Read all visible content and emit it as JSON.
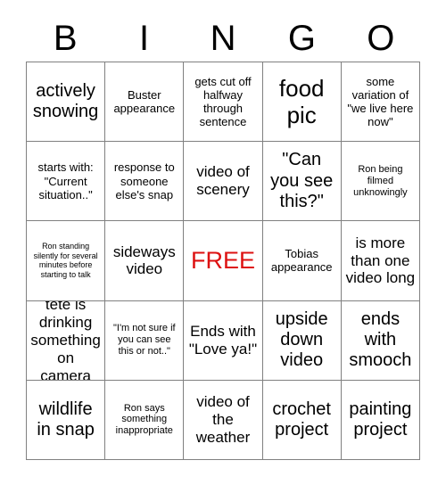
{
  "card": {
    "title": "BINGO",
    "header_letters": [
      "B",
      "I",
      "N",
      "G",
      "O"
    ],
    "free_space_color": "#dd1111",
    "border_color": "#808080",
    "background_color": "#ffffff",
    "text_color": "#000000",
    "rows": 5,
    "columns": 5,
    "cells": [
      {
        "id": "b1",
        "text": "actively snowing",
        "size": "lg",
        "free": false
      },
      {
        "id": "i1",
        "text": "Buster appearance",
        "size": "sm",
        "free": false
      },
      {
        "id": "n1",
        "text": "gets cut off halfway through sentence",
        "size": "sm",
        "free": false
      },
      {
        "id": "g1",
        "text": "food pic",
        "size": "xl",
        "free": false
      },
      {
        "id": "o1",
        "text": "some variation of \"we live here now\"",
        "size": "sm",
        "free": false
      },
      {
        "id": "b2",
        "text": "starts with: \"Current situation..\"",
        "size": "sm",
        "free": false
      },
      {
        "id": "i2",
        "text": "response to someone else's snap",
        "size": "sm",
        "free": false
      },
      {
        "id": "n2",
        "text": "video of scenery",
        "size": "md",
        "free": false
      },
      {
        "id": "g2",
        "text": "\"Can you see this?\"",
        "size": "lg",
        "free": false
      },
      {
        "id": "o2",
        "text": "Ron being filmed unknowingly",
        "size": "xs",
        "free": false
      },
      {
        "id": "b3",
        "text": "Ron standing silently for several minutes before starting to talk",
        "size": "xxs",
        "free": false
      },
      {
        "id": "i3",
        "text": "sideways video",
        "size": "md",
        "free": false
      },
      {
        "id": "n3",
        "text": "FREE",
        "size": "xl",
        "free": true
      },
      {
        "id": "g3",
        "text": "Tobias appearance",
        "size": "sm",
        "free": false
      },
      {
        "id": "o3",
        "text": "is more than one video long",
        "size": "md",
        "free": false
      },
      {
        "id": "b4",
        "text": "tete is drinking something on camera",
        "size": "md",
        "free": false
      },
      {
        "id": "i4",
        "text": "\"I'm not sure if you can see this or not..\"",
        "size": "xs",
        "free": false
      },
      {
        "id": "n4",
        "text": "Ends with \"Love ya!\"",
        "size": "md",
        "free": false
      },
      {
        "id": "g4",
        "text": "upside down video",
        "size": "lg",
        "free": false
      },
      {
        "id": "o4",
        "text": "ends with smooch",
        "size": "lg",
        "free": false
      },
      {
        "id": "b5",
        "text": "wildlife in snap",
        "size": "lg",
        "free": false
      },
      {
        "id": "i5",
        "text": "Ron says something inappropriate",
        "size": "xs",
        "free": false
      },
      {
        "id": "n5",
        "text": "video of the weather",
        "size": "md",
        "free": false
      },
      {
        "id": "g5",
        "text": "crochet project",
        "size": "lg",
        "free": false
      },
      {
        "id": "o5",
        "text": "painting project",
        "size": "lg",
        "free": false
      }
    ]
  }
}
